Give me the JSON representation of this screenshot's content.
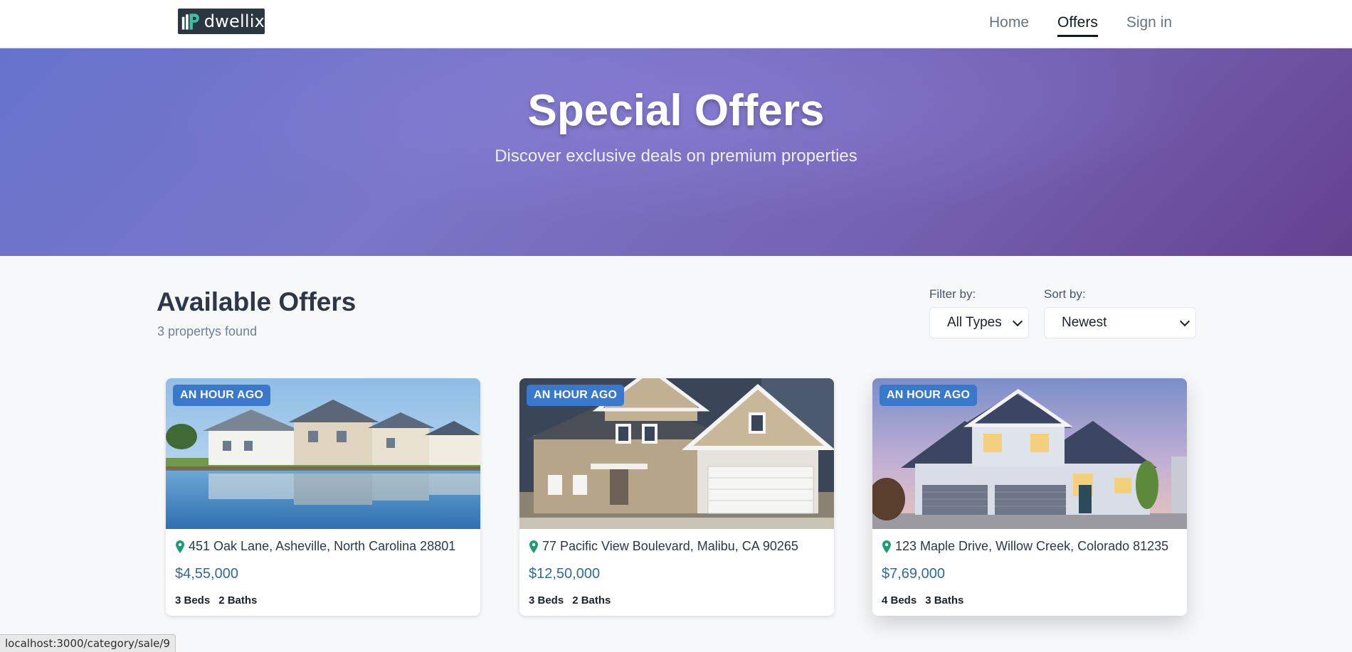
{
  "header": {
    "logo_text": "dwellix",
    "nav": [
      {
        "label": "Home",
        "active": false
      },
      {
        "label": "Offers",
        "active": true
      },
      {
        "label": "Sign in",
        "active": false
      }
    ]
  },
  "hero": {
    "title": "Special Offers",
    "subtitle": "Discover exclusive deals on premium properties"
  },
  "listing": {
    "title": "Available Offers",
    "count_text": "3 propertys found",
    "filter": {
      "label": "Filter by:",
      "value": "All Types"
    },
    "sort": {
      "label": "Sort by:",
      "value": "Newest"
    }
  },
  "cards": [
    {
      "badge": "AN HOUR AGO",
      "address": "451 Oak Lane, Asheville, North Carolina 28801",
      "price": "$4,55,000",
      "beds": "3 Beds",
      "baths": "2 Baths",
      "image": "lakeside-houses-photo"
    },
    {
      "badge": "AN HOUR AGO",
      "address": "77 Pacific View Boulevard, Malibu, CA 90265",
      "price": "$12,50,000",
      "beds": "3 Beds",
      "baths": "2 Baths",
      "image": "suburban-house-photo"
    },
    {
      "badge": "AN HOUR AGO",
      "address": "123 Maple Drive, Willow Creek, Colorado 81235",
      "price": "$7,69,000",
      "beds": "4 Beds",
      "baths": "3 Baths",
      "image": "modern-house-dusk-photo"
    }
  ],
  "status_bar": {
    "url": "localhost:3000/category/sale/9"
  },
  "colors": {
    "badge": "#3a78cc",
    "price": "#2f6b9a",
    "pin": "#1a9e6e",
    "hero_start": "#6673cc",
    "hero_end": "#64418f"
  }
}
